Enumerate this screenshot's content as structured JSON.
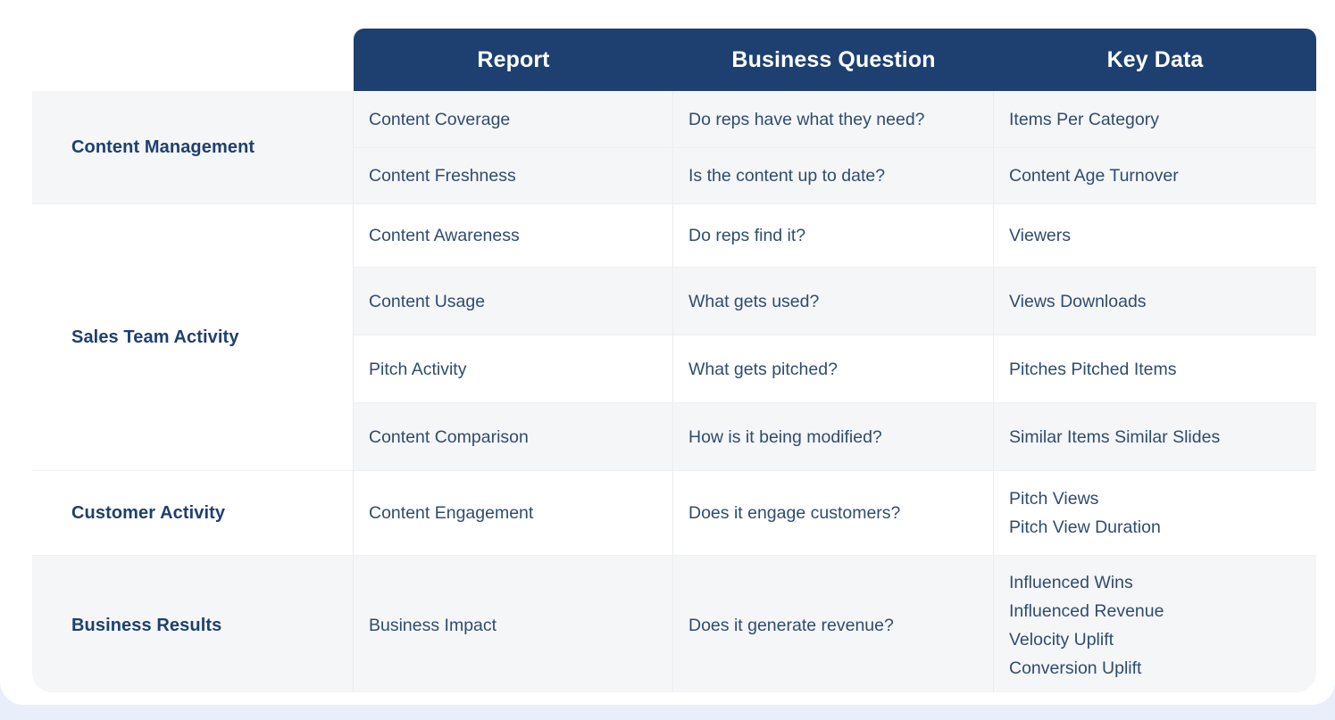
{
  "theme": {
    "header_bg": "#1e4070",
    "header_text": "#ffffff",
    "label_color": "#1e4070",
    "body_text": "#2f4c6e",
    "stripe_gray": "#f5f6f8",
    "stripe_white": "#ffffff",
    "page_bg": "#e8eefa",
    "divider": "#e9ecf1"
  },
  "table": {
    "columns": [
      {
        "key": "report",
        "label": "Report"
      },
      {
        "key": "question",
        "label": "Business Question"
      },
      {
        "key": "keydata",
        "label": "Key Data"
      }
    ],
    "groups": [
      {
        "label": "Content Management",
        "shade": "gray",
        "rows": [
          {
            "report": "Content Coverage",
            "question": "Do reps have what they need?",
            "keydata": [
              "Items Per Category"
            ],
            "shade": "gray"
          },
          {
            "report": "Content Freshness",
            "question": "Is the content up to date?",
            "keydata": [
              "Content Age Turnover"
            ],
            "shade": "gray"
          }
        ]
      },
      {
        "label": "Sales Team Activity",
        "shade": "white",
        "rows": [
          {
            "report": "Content Awareness",
            "question": "Do reps find it?",
            "keydata": [
              "Viewers"
            ],
            "shade": "white"
          },
          {
            "report": "Content Usage",
            "question": "What gets used?",
            "keydata": [
              "Views Downloads"
            ],
            "shade": "gray"
          },
          {
            "report": "Pitch Activity",
            "question": "What gets pitched?",
            "keydata": [
              "Pitches Pitched Items"
            ],
            "shade": "white"
          },
          {
            "report": "Content Comparison",
            "question": "How is it being modified?",
            "keydata": [
              "Similar Items Similar Slides"
            ],
            "shade": "gray"
          }
        ]
      },
      {
        "label": "Customer Activity",
        "shade": "white",
        "rows": [
          {
            "report": "Content Engagement",
            "question": "Does it engage customers?",
            "keydata": [
              "Pitch Views",
              "Pitch View Duration"
            ],
            "shade": "white"
          }
        ]
      },
      {
        "label": "Business Results",
        "shade": "gray",
        "rows": [
          {
            "report": "Business Impact",
            "question": "Does it generate revenue?",
            "keydata": [
              "Influenced Wins",
              "Influenced Revenue",
              "Velocity Uplift",
              "Conversion Uplift"
            ],
            "shade": "gray"
          }
        ]
      }
    ]
  }
}
